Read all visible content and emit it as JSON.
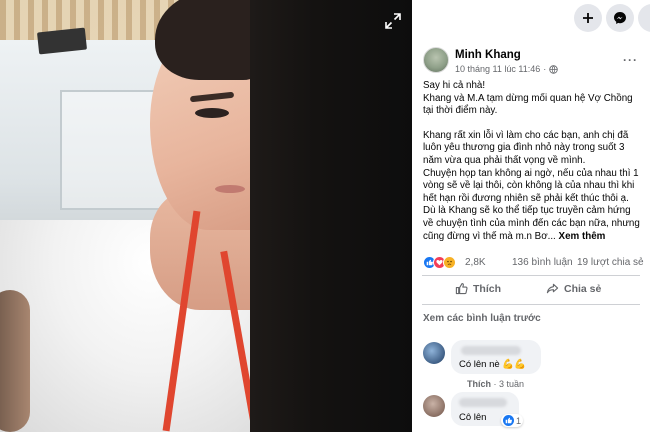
{
  "post": {
    "author": "Minh Khang",
    "timestamp": "10 tháng 11 lúc 11:46",
    "privacy_dot": "·",
    "more": "···",
    "paragraphs": [
      "Say hi cả nhà!\nKhang và M.A tạm dừng mối quan hệ Vợ Chồng tại thời điểm này.",
      "Khang rất xin lỗi vì làm cho các bạn, anh chị đã luôn yêu thương gia đình nhỏ này trong suốt 3 năm vừa qua phải thất vọng về mình."
    ],
    "body_tail": "Chuyện họp tan không ai ngờ, nếu của nhau thì 1 vòng sẽ về lại thôi, còn không là của nhau thì khi hết hạn rồi đương nhiên sẽ phải kết thúc thôi ạ. Dù là Khang sẽ ko thể tiếp tục truyền cảm hứng về chuyện tình của mình đến các bạn nữa, nhưng cũng đừng vì thế mà m.n Bơ...",
    "see_more": "Xem thêm",
    "reaction_count": "2,8K",
    "comment_count": "136 bình luận",
    "share_count": "19 lượt chia sẻ",
    "like_label": "Thích",
    "share_label": "Chia sẻ"
  },
  "comments": {
    "view_previous": "Xem các bình luận trước",
    "items": [
      {
        "text": "Có lên nè 💪💪",
        "like_action": "Thích",
        "time": "3 tuần"
      },
      {
        "text": "Cô lên",
        "like_count": "1"
      }
    ]
  },
  "icons": {
    "expand": "expand-icon",
    "plus": "plus-icon",
    "messenger": "messenger-icon",
    "globe": "globe-icon",
    "like": "thumbs-up-icon",
    "share": "share-icon"
  },
  "colors": {
    "accent": "#1877f2",
    "love": "#f33e58",
    "sad": "#f7b125",
    "muted_text": "#65676b"
  }
}
